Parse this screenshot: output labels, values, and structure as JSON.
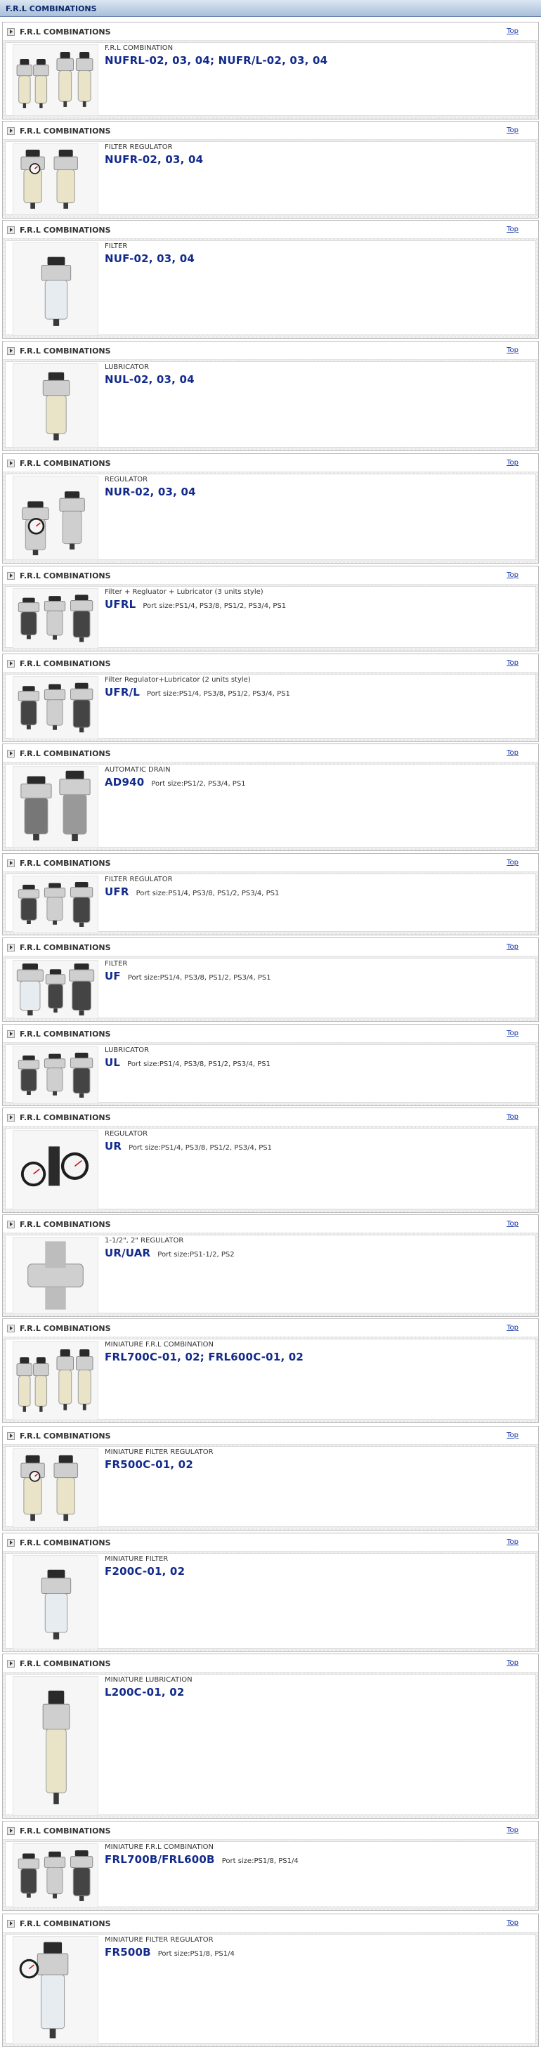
{
  "header": {
    "title": "F.R.L COMBINATIONS"
  },
  "sections": [
    {
      "category": "F.R.L COMBINATIONS",
      "top_link": "Top",
      "description": "F.R.L COMBINATION",
      "model": "NUFRL-02, 03, 04; NUFR/L-02, 03, 04",
      "port": "",
      "image": "frl-combination"
    },
    {
      "category": "F.R.L COMBINATIONS",
      "top_link": "Top",
      "description": "FILTER REGULATOR",
      "model": "NUFR-02, 03, 04",
      "port": "",
      "image": "filter-regulator"
    },
    {
      "category": "F.R.L COMBINATIONS",
      "top_link": "Top",
      "description": "FILTER",
      "model": "NUF-02, 03, 04",
      "port": "",
      "image": "filter"
    },
    {
      "category": "F.R.L COMBINATIONS",
      "top_link": "Top",
      "description": "LUBRICATOR",
      "model": "NUL-02, 03, 04",
      "port": "",
      "image": "lubricator"
    },
    {
      "category": "F.R.L COMBINATIONS",
      "top_link": "Top",
      "description": "REGULATOR",
      "model": "NUR-02, 03, 04",
      "port": "",
      "image": "regulator"
    },
    {
      "category": "F.R.L COMBINATIONS",
      "top_link": "Top",
      "description": "Filter + Regluator + Lubricator (3 units style)",
      "model": "UFRL",
      "port": "Port size:PS1/4, PS3/8, PS1/2, PS3/4, PS1",
      "image": "frl-3-units"
    },
    {
      "category": "F.R.L COMBINATIONS",
      "top_link": "Top",
      "description": "Filter Regulator+Lubricator (2 units style)",
      "model": "UFR/L",
      "port": "Port size:PS1/4, PS3/8, PS1/2, PS3/4, PS1",
      "image": "frl-2-units"
    },
    {
      "category": "F.R.L COMBINATIONS",
      "top_link": "Top",
      "description": "AUTOMATIC DRAIN",
      "model": "AD940",
      "port": "Port size:PS1/2, PS3/4, PS1",
      "image": "automatic-drain"
    },
    {
      "category": "F.R.L COMBINATIONS",
      "top_link": "Top",
      "description": "FILTER REGULATOR",
      "model": "UFR",
      "port": "Port size:PS1/4, PS3/8, PS1/2, PS3/4, PS1",
      "image": "filter-regulator-set"
    },
    {
      "category": "F.R.L COMBINATIONS",
      "top_link": "Top",
      "description": "FILTER",
      "model": "UF",
      "port": "Port size:PS1/4, PS3/8, PS1/2, PS3/4, PS1",
      "image": "filter-set"
    },
    {
      "category": "F.R.L COMBINATIONS",
      "top_link": "Top",
      "description": "LUBRICATOR",
      "model": "UL",
      "port": "Port size:PS1/4, PS3/8, PS1/2, PS3/4, PS1",
      "image": "lubricator-set"
    },
    {
      "category": "F.R.L COMBINATIONS",
      "top_link": "Top",
      "description": "REGULATOR",
      "model": "UR",
      "port": "Port size:PS1/4, PS3/8, PS1/2, PS3/4, PS1",
      "image": "regulator-set"
    },
    {
      "category": "F.R.L COMBINATIONS",
      "top_link": "Top",
      "description": "1-1/2\", 2\" REGULATOR",
      "model": "UR/UAR",
      "port": "Port size:PS1-1/2, PS2",
      "image": "large-regulator"
    },
    {
      "category": "F.R.L COMBINATIONS",
      "top_link": "Top",
      "description": "MINIATURE F.R.L COMBINATION",
      "model": "FRL700C-01, 02; FRL600C-01, 02",
      "port": "",
      "image": "miniature-frl"
    },
    {
      "category": "F.R.L COMBINATIONS",
      "top_link": "Top",
      "description": "MINIATURE FILTER REGULATOR",
      "model": "FR500C-01, 02",
      "port": "",
      "image": "miniature-filter-regulator"
    },
    {
      "category": "F.R.L COMBINATIONS",
      "top_link": "Top",
      "description": "MINIATURE FILTER",
      "model": "F200C-01, 02",
      "port": "",
      "image": "miniature-filter"
    },
    {
      "category": "F.R.L COMBINATIONS",
      "top_link": "Top",
      "description": "MINIATURE LUBRICATION",
      "model": "L200C-01, 02",
      "port": "",
      "image": "miniature-lubricator"
    },
    {
      "category": "F.R.L COMBINATIONS",
      "top_link": "Top",
      "description": "MINIATURE F.R.L COMBINATION",
      "model": "FRL700B/FRL600B",
      "port": "Port size:PS1/8, PS1/4",
      "image": "miniature-frl-b"
    },
    {
      "category": "F.R.L COMBINATIONS",
      "top_link": "Top",
      "description": "MINIATURE FILTER REGULATOR",
      "model": "FR500B",
      "port": "Port size:PS1/8, PS1/4",
      "image": "miniature-filter-regulator-b"
    }
  ]
}
